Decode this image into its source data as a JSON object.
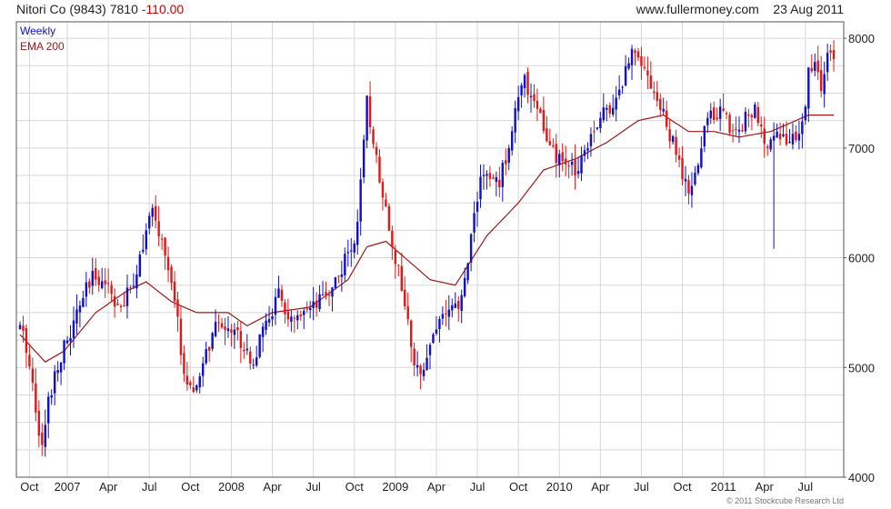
{
  "header": {
    "symbol": "Nitori Co (9843)",
    "price": "7810",
    "change": "-110.00",
    "website": "www.fullermoney.com",
    "date": "23 Aug 2011"
  },
  "legend": {
    "weekly": "Weekly",
    "ema": "EMA 200"
  },
  "copyright": "© 2011 Stockcube Research Ltd",
  "colors": {
    "up": "#1010c8",
    "down": "#e01818",
    "ema": "#a01818",
    "grid": "#d8d8d8",
    "frame": "#555555",
    "neg_text": "#cc0000"
  },
  "chart_data": {
    "type": "candlestick",
    "frequency": "weekly",
    "x_tick_labels": [
      "Oct",
      "2007",
      "Apr",
      "Jul",
      "Oct",
      "2008",
      "Apr",
      "Jul",
      "Oct",
      "2009",
      "Apr",
      "Jul",
      "Oct",
      "2010",
      "Apr",
      "Jul",
      "Oct",
      "2011",
      "Apr",
      "Jul"
    ],
    "x_ticks_week_index": [
      3,
      15,
      28,
      41,
      54,
      67,
      80,
      93,
      106,
      119,
      132,
      145,
      158,
      171,
      184,
      197,
      210,
      223,
      236,
      249
    ],
    "y_ticks": [
      4000,
      5000,
      6000,
      7000,
      8000
    ],
    "ylim": [
      4000,
      8150
    ],
    "start_week": "2006-09-08",
    "grid": true,
    "ema_series": {
      "name": "EMA 200",
      "anchors": [
        [
          0,
          5300
        ],
        [
          8,
          5050
        ],
        [
          14,
          5150
        ],
        [
          24,
          5500
        ],
        [
          34,
          5700
        ],
        [
          40,
          5780
        ],
        [
          48,
          5600
        ],
        [
          56,
          5500
        ],
        [
          66,
          5500
        ],
        [
          72,
          5380
        ],
        [
          80,
          5500
        ],
        [
          92,
          5550
        ],
        [
          104,
          5800
        ],
        [
          110,
          6100
        ],
        [
          116,
          6150
        ],
        [
          124,
          5950
        ],
        [
          130,
          5800
        ],
        [
          138,
          5750
        ],
        [
          148,
          6200
        ],
        [
          158,
          6500
        ],
        [
          166,
          6800
        ],
        [
          176,
          6900
        ],
        [
          186,
          7050
        ],
        [
          196,
          7250
        ],
        [
          204,
          7300
        ],
        [
          212,
          7150
        ],
        [
          220,
          7150
        ],
        [
          228,
          7100
        ],
        [
          238,
          7150
        ],
        [
          250,
          7300
        ]
      ]
    },
    "price_anchors": [
      [
        0,
        5350
      ],
      [
        2,
        5200
      ],
      [
        4,
        4850
      ],
      [
        7,
        4250
      ],
      [
        9,
        4700
      ],
      [
        12,
        5050
      ],
      [
        16,
        5300
      ],
      [
        20,
        5650
      ],
      [
        24,
        5850
      ],
      [
        28,
        5750
      ],
      [
        32,
        5500
      ],
      [
        36,
        5800
      ],
      [
        40,
        6250
      ],
      [
        42,
        6400
      ],
      [
        46,
        6050
      ],
      [
        50,
        5400
      ],
      [
        52,
        4950
      ],
      [
        55,
        4700
      ],
      [
        58,
        5050
      ],
      [
        62,
        5350
      ],
      [
        66,
        5400
      ],
      [
        70,
        5250
      ],
      [
        74,
        5050
      ],
      [
        78,
        5400
      ],
      [
        82,
        5650
      ],
      [
        86,
        5400
      ],
      [
        90,
        5450
      ],
      [
        94,
        5550
      ],
      [
        98,
        5700
      ],
      [
        102,
        5900
      ],
      [
        106,
        6150
      ],
      [
        108,
        6650
      ],
      [
        110,
        7400
      ],
      [
        113,
        6900
      ],
      [
        116,
        6450
      ],
      [
        119,
        6000
      ],
      [
        122,
        5600
      ],
      [
        125,
        4950
      ],
      [
        128,
        5050
      ],
      [
        131,
        5300
      ],
      [
        134,
        5500
      ],
      [
        137,
        5500
      ],
      [
        140,
        5600
      ],
      [
        143,
        6200
      ],
      [
        146,
        6750
      ],
      [
        149,
        6700
      ],
      [
        152,
        6700
      ],
      [
        154,
        6900
      ],
      [
        157,
        7350
      ],
      [
        160,
        7600
      ],
      [
        164,
        7400
      ],
      [
        167,
        7050
      ],
      [
        170,
        6900
      ],
      [
        173,
        6850
      ],
      [
        176,
        6800
      ],
      [
        179,
        7000
      ],
      [
        182,
        7200
      ],
      [
        186,
        7350
      ],
      [
        190,
        7500
      ],
      [
        194,
        7900
      ],
      [
        196,
        7900
      ],
      [
        199,
        7650
      ],
      [
        202,
        7450
      ],
      [
        205,
        7200
      ],
      [
        208,
        6950
      ],
      [
        212,
        6550
      ],
      [
        215,
        6850
      ],
      [
        218,
        7300
      ],
      [
        222,
        7350
      ],
      [
        225,
        7200
      ],
      [
        228,
        7150
      ],
      [
        230,
        7300
      ],
      [
        233,
        7350
      ],
      [
        236,
        7000
      ],
      [
        238,
        7150
      ],
      [
        242,
        7100
      ],
      [
        246,
        7050
      ],
      [
        248,
        7200
      ],
      [
        250,
        7700
      ],
      [
        252,
        7750
      ],
      [
        254,
        7550
      ],
      [
        256,
        7850
      ],
      [
        258,
        7810
      ]
    ],
    "last_close": 7810
  }
}
